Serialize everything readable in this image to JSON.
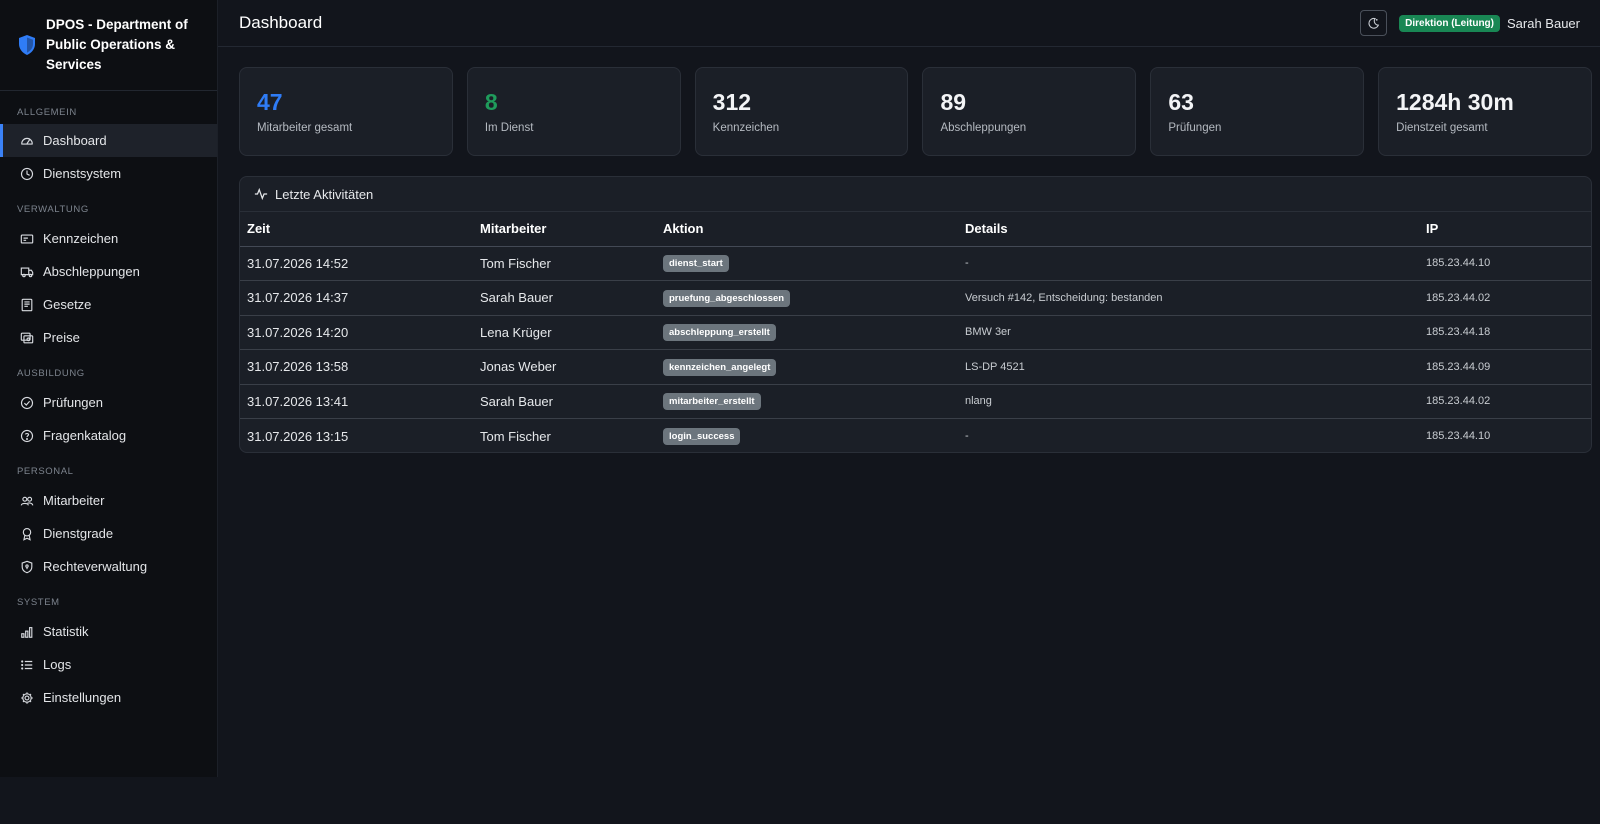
{
  "brand": {
    "title": "DPOS - Department of Public Operations & Services"
  },
  "sidebar": {
    "sections": [
      {
        "label": "ALLGEMEIN",
        "items": [
          {
            "label": "Dashboard",
            "icon": "speedometer-icon",
            "active": true
          },
          {
            "label": "Dienstsystem",
            "icon": "clock-icon"
          }
        ]
      },
      {
        "label": "VERWALTUNG",
        "items": [
          {
            "label": "Kennzeichen",
            "icon": "license-plate-icon"
          },
          {
            "label": "Abschleppungen",
            "icon": "truck-icon"
          },
          {
            "label": "Gesetze",
            "icon": "book-icon"
          },
          {
            "label": "Preise",
            "icon": "price-tag-icon"
          }
        ]
      },
      {
        "label": "AUSBILDUNG",
        "items": [
          {
            "label": "Prüfungen",
            "icon": "check-circle-icon"
          },
          {
            "label": "Fragenkatalog",
            "icon": "question-circle-icon"
          }
        ]
      },
      {
        "label": "PERSONAL",
        "items": [
          {
            "label": "Mitarbeiter",
            "icon": "people-icon"
          },
          {
            "label": "Dienstgrade",
            "icon": "award-icon"
          },
          {
            "label": "Rechteverwaltung",
            "icon": "shield-lock-icon"
          }
        ]
      },
      {
        "label": "SYSTEM",
        "items": [
          {
            "label": "Statistik",
            "icon": "bar-chart-icon"
          },
          {
            "label": "Logs",
            "icon": "list-icon"
          },
          {
            "label": "Einstellungen",
            "icon": "gear-icon"
          }
        ]
      }
    ]
  },
  "header": {
    "title": "Dashboard",
    "role": "Direktion (Leitung)",
    "user": "Sarah Bauer"
  },
  "stats": [
    {
      "value": "47",
      "label": "Mitarbeiter gesamt",
      "color": "#2f7cf6"
    },
    {
      "value": "8",
      "label": "Im Dienst",
      "color": "#1f9b5b"
    },
    {
      "value": "312",
      "label": "Kennzeichen"
    },
    {
      "value": "89",
      "label": "Abschleppungen"
    },
    {
      "value": "63",
      "label": "Prüfungen"
    },
    {
      "value": "1284h 30m",
      "label": "Dienstzeit gesamt"
    }
  ],
  "activity": {
    "title": "Letzte Aktivitäten",
    "columns": [
      "Zeit",
      "Mitarbeiter",
      "Aktion",
      "Details",
      "IP"
    ],
    "rows": [
      {
        "time": "31.07.2026 14:52",
        "employee": "Tom Fischer",
        "action": "dienst_start",
        "details": "-",
        "ip": "185.23.44.10"
      },
      {
        "time": "31.07.2026 14:37",
        "employee": "Sarah Bauer",
        "action": "pruefung_abgeschlossen",
        "details": "Versuch #142, Entscheidung: bestanden",
        "ip": "185.23.44.02"
      },
      {
        "time": "31.07.2026 14:20",
        "employee": "Lena Krüger",
        "action": "abschleppung_erstellt",
        "details": "BMW 3er",
        "ip": "185.23.44.18"
      },
      {
        "time": "31.07.2026 13:58",
        "employee": "Jonas Weber",
        "action": "kennzeichen_angelegt",
        "details": "LS-DP 4521",
        "ip": "185.23.44.09"
      },
      {
        "time": "31.07.2026 13:41",
        "employee": "Sarah Bauer",
        "action": "mitarbeiter_erstellt",
        "details": "nlang",
        "ip": "185.23.44.02"
      },
      {
        "time": "31.07.2026 13:15",
        "employee": "Tom Fischer",
        "action": "login_success",
        "details": "-",
        "ip": "185.23.44.10"
      }
    ]
  }
}
